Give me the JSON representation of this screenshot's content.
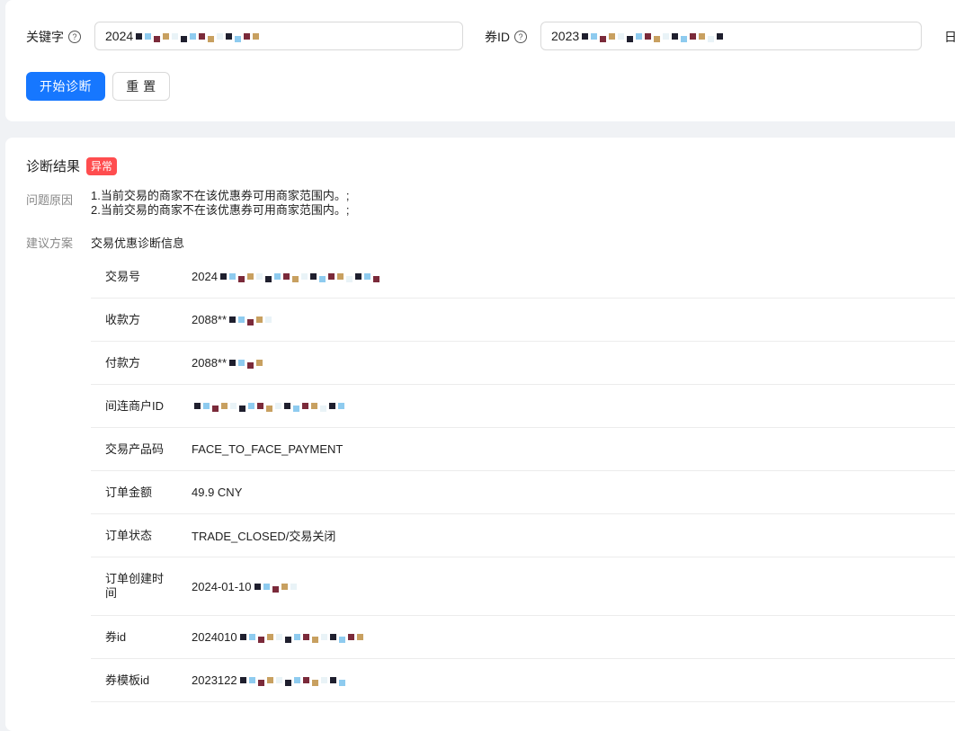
{
  "form": {
    "keyword_label": "关键字",
    "keyword_value": "2024",
    "coupon_label": "券ID",
    "coupon_value": "2023",
    "date_label": "日",
    "help_glyph": "?",
    "start_button": "开始诊断",
    "reset_button": "重 置"
  },
  "result": {
    "title": "诊断结果",
    "status_tag": "异常",
    "status_color": "#ff4d4f",
    "reason_label": "问题原因",
    "reasons": [
      "1.当前交易的商家不在该优惠券可用商家范围内。;",
      "2.当前交易的商家不在该优惠券可用商家范围内。;"
    ],
    "suggest_label": "建议方案",
    "suggest_title": "交易优惠诊断信息",
    "rows": [
      {
        "label": "交易号",
        "value": "2024"
      },
      {
        "label": "收款方",
        "value": "2088**"
      },
      {
        "label": "付款方",
        "value": "2088**"
      },
      {
        "label": "间连商户ID",
        "value": ""
      },
      {
        "label": "交易产品码",
        "value": "FACE_TO_FACE_PAYMENT"
      },
      {
        "label": "订单金额",
        "value": "49.9 CNY"
      },
      {
        "label": "订单状态",
        "value": "TRADE_CLOSED/交易关闭"
      },
      {
        "label": "订单创建时间",
        "value": "2024-01-10"
      },
      {
        "label": "券id",
        "value": "2024010"
      },
      {
        "label": "券模板id",
        "value": "2023122"
      }
    ]
  },
  "colors": {
    "primary": "#1677ff",
    "page_bg": "#f0f2f5"
  }
}
